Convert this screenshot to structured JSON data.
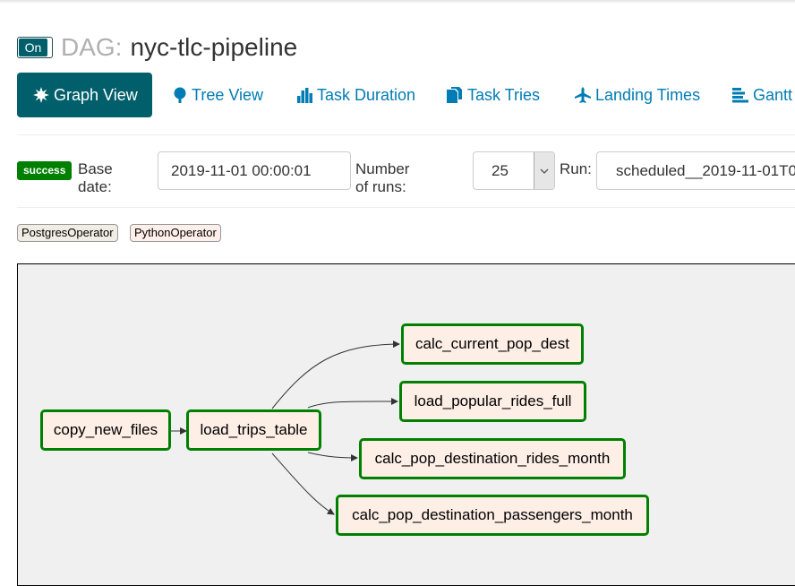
{
  "header": {
    "toggle_label": "On",
    "dag_prefix": "DAG:",
    "dag_id": "nyc-tlc-pipeline"
  },
  "tabs": [
    {
      "label": "Graph View",
      "icon": "asterisk-icon",
      "active": true
    },
    {
      "label": "Tree View",
      "icon": "tree-icon",
      "active": false
    },
    {
      "label": "Task Duration",
      "icon": "bar-chart-icon",
      "active": false
    },
    {
      "label": "Task Tries",
      "icon": "duplicate-icon",
      "active": false
    },
    {
      "label": "Landing Times",
      "icon": "plane-icon",
      "active": false
    },
    {
      "label": "Gantt",
      "icon": "gantt-icon",
      "active": false
    }
  ],
  "filters": {
    "state_badge": "success",
    "base_date_label": "Base date:",
    "base_date_value": "2019-11-01 00:00:01",
    "num_runs_label": "Number of runs:",
    "num_runs_value": "25",
    "run_label": "Run:",
    "run_value": "scheduled__2019-11-01T0"
  },
  "legend": [
    "PostgresOperator",
    "PythonOperator"
  ],
  "graph": {
    "nodes": [
      {
        "id": "copy_new_files"
      },
      {
        "id": "load_trips_table"
      },
      {
        "id": "calc_current_pop_dest"
      },
      {
        "id": "load_popular_rides_full"
      },
      {
        "id": "calc_pop_destination_rides_month"
      },
      {
        "id": "calc_pop_destination_passengers_month"
      }
    ],
    "node_state_color": "#008000",
    "node_fill": "#fdeee6"
  },
  "colors": {
    "accent": "#005f6b",
    "link": "#017cb4",
    "success": "#008000"
  }
}
